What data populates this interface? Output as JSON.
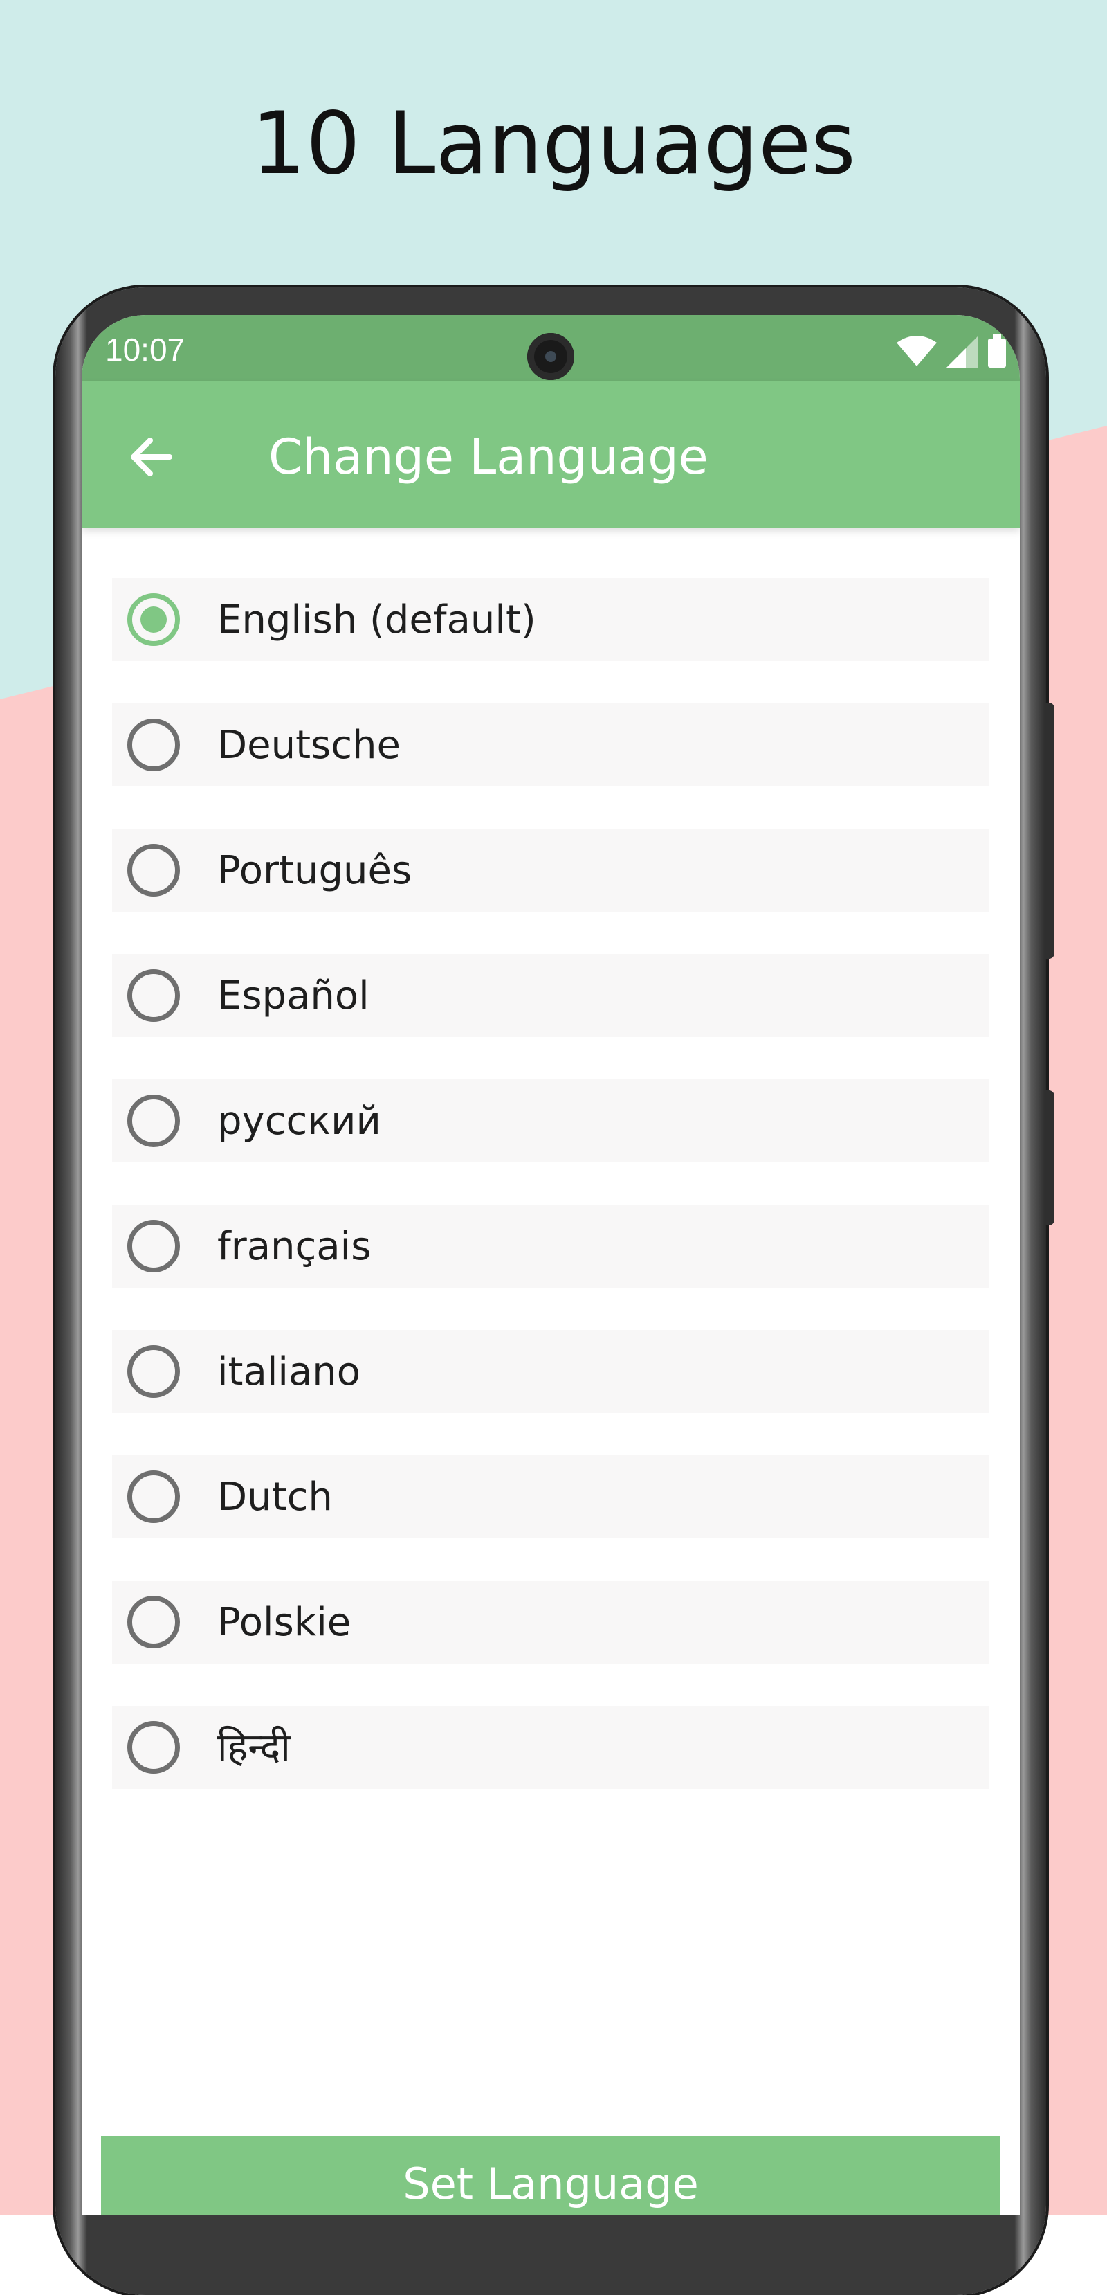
{
  "promo": {
    "headline": "10 Languages"
  },
  "colors": {
    "bg_teal": "#cfecea",
    "bg_pink": "#fccbca",
    "status_bar": "#6daf70",
    "app_bar": "#80c784",
    "accent": "#80c784",
    "radio_unchecked": "#6f6f6f",
    "item_bg": "#f8f7f7"
  },
  "status_bar": {
    "time": "10:07",
    "icons": [
      "wifi-icon",
      "signal-icon",
      "battery-icon"
    ]
  },
  "app_bar": {
    "back_icon": "arrow-left-icon",
    "title": "Change Language"
  },
  "languages": [
    {
      "label": "English (default)",
      "selected": true
    },
    {
      "label": "Deutsche",
      "selected": false
    },
    {
      "label": "Português",
      "selected": false
    },
    {
      "label": "Español",
      "selected": false
    },
    {
      "label": "русский",
      "selected": false
    },
    {
      "label": "français",
      "selected": false
    },
    {
      "label": "italiano",
      "selected": false
    },
    {
      "label": "Dutch",
      "selected": false
    },
    {
      "label": "Polskie",
      "selected": false
    },
    {
      "label": "हिन्दी",
      "selected": false
    }
  ],
  "footer": {
    "set_button_label": "Set Language"
  }
}
